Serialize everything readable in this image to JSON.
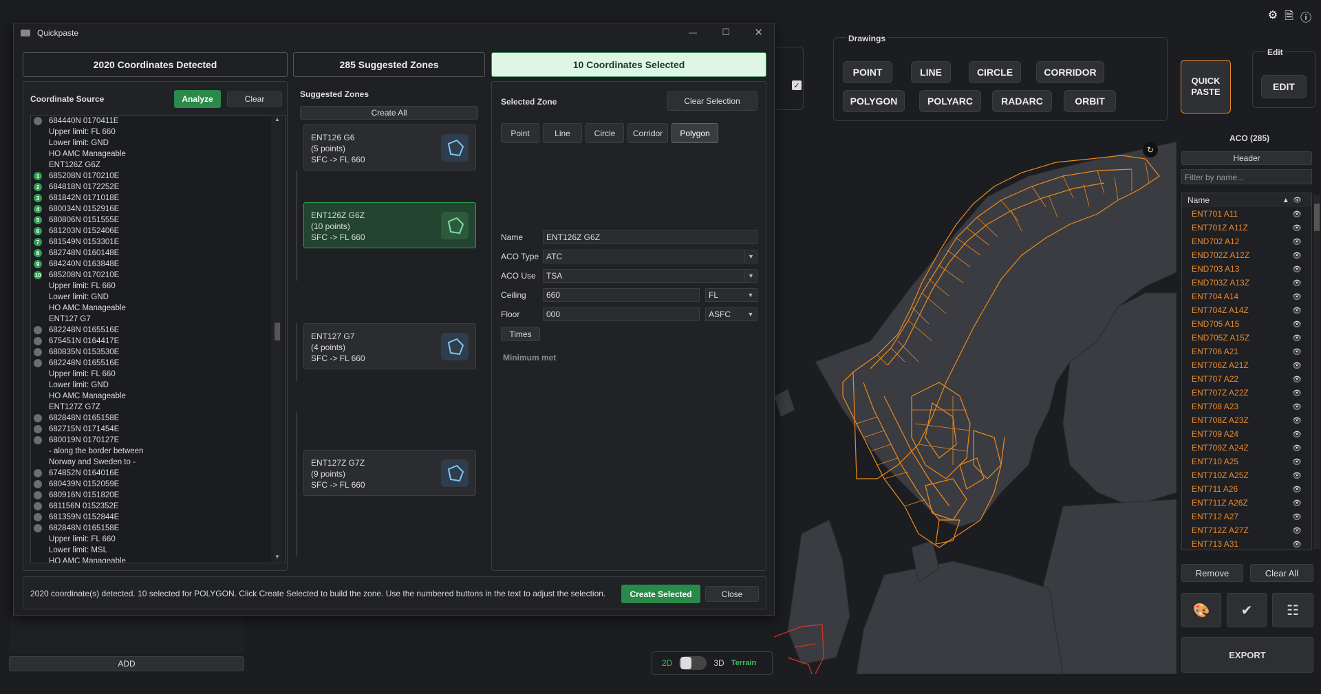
{
  "topbar": {
    "icons": [
      "gear-icon",
      "document-icon",
      "info-icon"
    ]
  },
  "drawings": {
    "label": "Drawings",
    "buttons": [
      "POINT",
      "LINE",
      "CIRCLE",
      "CORRIDOR",
      "POLYGON",
      "POLYARC",
      "RADARC",
      "ORBIT"
    ],
    "quick_paste": "QUICK\nPASTE"
  },
  "edit": {
    "label": "Edit",
    "button": "EDIT"
  },
  "aco_panel": {
    "title": "ACO (285)",
    "header_btn": "Header",
    "filter_placeholder": "Filter by name...",
    "col_name": "Name",
    "rows": [
      "ENT701 A11",
      "ENT701Z A11Z",
      "END702 A12",
      "END702Z A12Z",
      "END703 A13",
      "END703Z A13Z",
      "ENT704 A14",
      "ENT704Z A14Z",
      "END705 A15",
      "END705Z A15Z",
      "ENT706 A21",
      "ENT706Z A21Z",
      "ENT707 A22",
      "ENT707Z A22Z",
      "ENT708 A23",
      "ENT708Z A23Z",
      "ENT709 A24",
      "ENT709Z A24Z",
      "ENT710 A25",
      "ENT710Z A25Z",
      "ENT711 A26",
      "ENT711Z A26Z",
      "ENT712 A27",
      "ENT712Z A27Z",
      "ENT713 A31"
    ],
    "remove": "Remove",
    "clear_all": "Clear All",
    "export": "EXPORT"
  },
  "view_toggle": {
    "d2": "2D",
    "d3": "3D",
    "terrain": "Terrain"
  },
  "left_app": {
    "add": "ADD"
  },
  "dialog": {
    "title": "Quickpaste",
    "tab_detected": "2020 Coordinates Detected",
    "tab_suggested": "285 Suggested Zones",
    "tab_selected": "10 Coordinates Selected",
    "source": {
      "label": "Coordinate Source",
      "analyze": "Analyze",
      "clear": "Clear",
      "lines": [
        {
          "m": "dot",
          "t": "684440N 0170411E"
        },
        {
          "m": "",
          "t": "Upper limit: FL 660"
        },
        {
          "m": "",
          "t": "Lower limit: GND"
        },
        {
          "m": "",
          "t": "HO AMC Manageable"
        },
        {
          "m": "",
          "t": "ENT126Z G6Z"
        },
        {
          "m": "1",
          "t": "685208N 0170210E"
        },
        {
          "m": "2",
          "t": "684818N 0172252E"
        },
        {
          "m": "3",
          "t": "681842N 0171018E"
        },
        {
          "m": "4",
          "t": "680034N 0152916E"
        },
        {
          "m": "5",
          "t": "680806N 0151555E"
        },
        {
          "m": "6",
          "t": "681203N 0152406E"
        },
        {
          "m": "7",
          "t": "681549N 0153301E"
        },
        {
          "m": "8",
          "t": "682748N 0160148E"
        },
        {
          "m": "9",
          "t": "684240N 0163848E"
        },
        {
          "m": "10",
          "t": "685208N 0170210E"
        },
        {
          "m": "",
          "t": "Upper limit: FL 660"
        },
        {
          "m": "",
          "t": "Lower limit: GND"
        },
        {
          "m": "",
          "t": "HO AMC Manageable"
        },
        {
          "m": "",
          "t": "ENT127 G7"
        },
        {
          "m": "dot",
          "t": "682248N 0165516E"
        },
        {
          "m": "dot",
          "t": "675451N 0164417E"
        },
        {
          "m": "dot",
          "t": "680835N 0153530E"
        },
        {
          "m": "dot",
          "t": "682248N 0165516E"
        },
        {
          "m": "",
          "t": "Upper limit: FL 660"
        },
        {
          "m": "",
          "t": "Lower limit: GND"
        },
        {
          "m": "",
          "t": "HO AMC Manageable"
        },
        {
          "m": "",
          "t": "ENT127Z G7Z"
        },
        {
          "m": "dot",
          "t": "682848N 0165158E"
        },
        {
          "m": "dot",
          "t": "682715N 0171454E"
        },
        {
          "m": "dot",
          "t": "680019N 0170127E"
        },
        {
          "m": "",
          "t": "- along the border between"
        },
        {
          "m": "",
          "t": "Norway and Sweden to -"
        },
        {
          "m": "dot",
          "t": "674852N 0164016E"
        },
        {
          "m": "dot",
          "t": "680439N 0152059E"
        },
        {
          "m": "dot",
          "t": "680916N 0151820E"
        },
        {
          "m": "dot",
          "t": "681156N 0152352E"
        },
        {
          "m": "dot",
          "t": "681359N 0152844E"
        },
        {
          "m": "dot",
          "t": "682848N 0165158E"
        },
        {
          "m": "",
          "t": "Upper limit: FL 660"
        },
        {
          "m": "",
          "t": "Lower limit: MSL"
        },
        {
          "m": "",
          "t": "HO AMC Manageable"
        }
      ]
    },
    "suggested": {
      "label": "Suggested Zones",
      "create_all": "Create All",
      "zones": [
        {
          "name": "ENT126 G6",
          "points": "(5 points)",
          "limits": "SFC -> FL 660"
        },
        {
          "name": "ENT126Z G6Z",
          "points": "(10 points)",
          "limits": "SFC -> FL 660"
        },
        {
          "name": "ENT127 G7",
          "points": "(4 points)",
          "limits": "SFC -> FL 660"
        },
        {
          "name": "ENT127Z G7Z",
          "points": "(9 points)",
          "limits": "SFC -> FL 660"
        }
      ]
    },
    "selected": {
      "label": "Selected Zone",
      "clear_selection": "Clear Selection",
      "types": [
        "Point",
        "Line",
        "Circle",
        "Corridor",
        "Polygon"
      ],
      "name_label": "Name",
      "name": "ENT126Z G6Z",
      "type_label": "ACO Type",
      "type": "ATC",
      "use_label": "ACO Use",
      "use": "TSA",
      "ceiling_label": "Ceiling",
      "ceiling": "660",
      "ceiling_unit": "FL",
      "floor_label": "Floor",
      "floor": "000",
      "floor_unit": "ASFC",
      "times": "Times",
      "status": "Minimum met"
    },
    "footer": {
      "message": "2020 coordinate(s) detected. 10 selected for POLYGON. Click Create Selected to build the zone. Use the numbered buttons in the text to adjust the selection.",
      "create_selected": "Create Selected",
      "close": "Close"
    }
  }
}
